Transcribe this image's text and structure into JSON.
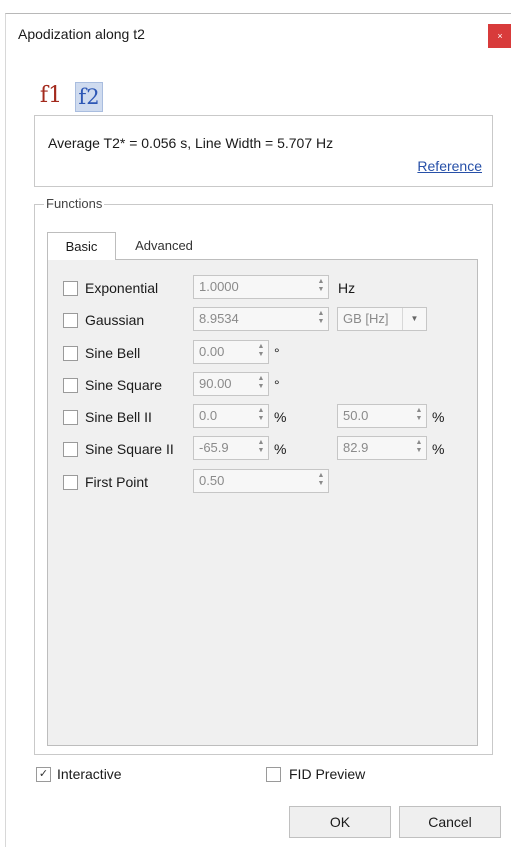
{
  "window": {
    "title": "Apodization along t2",
    "close_label": "×"
  },
  "dimension_buttons": {
    "f1": "f1",
    "f2": "f2"
  },
  "info": {
    "text": "Average T2* = 0.056 s, Line Width = 5.707 Hz",
    "reference_link": "Reference"
  },
  "functions": {
    "group_title": "Functions",
    "tabs": {
      "basic": "Basic",
      "advanced": "Advanced"
    },
    "rows": [
      {
        "label": "Exponential",
        "checked": false,
        "value": "1.0000",
        "unit": "Hz"
      },
      {
        "label": "Gaussian",
        "checked": false,
        "value": "8.9534",
        "combo_value": "GB [Hz]"
      },
      {
        "label": "Sine Bell",
        "checked": false,
        "value": "0.00",
        "unit": "°"
      },
      {
        "label": "Sine Square",
        "checked": false,
        "value": "90.00",
        "unit": "°"
      },
      {
        "label": "Sine Bell II",
        "checked": false,
        "value": "0.0",
        "unit": "%",
        "value2": "50.0",
        "unit2": "%"
      },
      {
        "label": "Sine Square II",
        "checked": false,
        "value": "-65.9",
        "unit": "%",
        "value2": "82.9",
        "unit2": "%"
      },
      {
        "label": "First Point",
        "checked": false,
        "value": "0.50"
      }
    ]
  },
  "options": {
    "interactive": {
      "label": "Interactive",
      "checked": true,
      "check_mark": "✓"
    },
    "fid_preview": {
      "label": "FID Preview",
      "checked": false
    }
  },
  "buttons": {
    "ok": "OK",
    "cancel": "Cancel"
  }
}
